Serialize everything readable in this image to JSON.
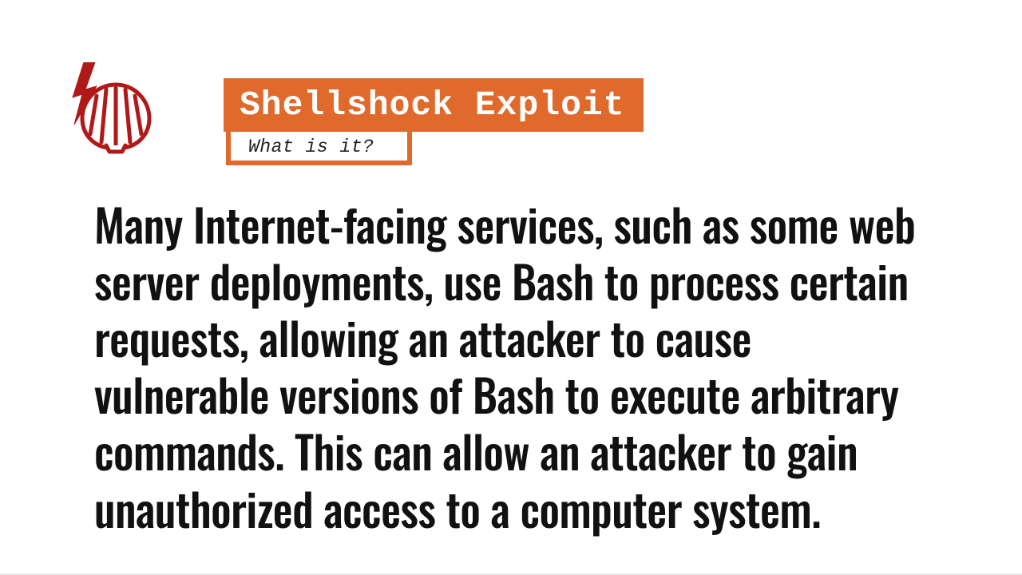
{
  "header": {
    "title": "Shellshock Exploit",
    "subtitle": "What is it?",
    "icon_name": "shellshock-shell-lightning-icon",
    "accent_color": "#e06a2b"
  },
  "body": {
    "paragraph": "Many Internet-facing services, such as some web server deployments, use Bash to process certain requests, allowing an attacker to cause vulnerable versions of Bash to execute arbitrary commands. This can allow an attacker to gain unauthorized access to a computer system."
  }
}
